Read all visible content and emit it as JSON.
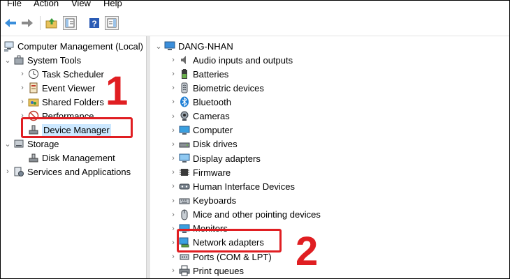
{
  "menu": [
    "File",
    "Action",
    "View",
    "Help"
  ],
  "toolbar": {
    "icons": [
      "back-arrow-icon",
      "forward-arrow-icon",
      "up-folder-icon",
      "show-hide-tree-icon",
      "help-icon",
      "properties-icon"
    ]
  },
  "tree": {
    "root": "Computer Management (Local)",
    "items": [
      {
        "label": "System Tools",
        "icon": "toolbox-icon"
      },
      {
        "label": "Task Scheduler",
        "icon": "clock-icon"
      },
      {
        "label": "Event Viewer",
        "icon": "event-viewer-icon"
      },
      {
        "label": "Shared Folders",
        "icon": "shared-folder-icon"
      },
      {
        "label": "Performance",
        "icon": "performance-icon"
      },
      {
        "label": "Device Manager",
        "icon": "device-manager-icon"
      },
      {
        "label": "Storage",
        "icon": "storage-icon"
      },
      {
        "label": "Disk Management",
        "icon": "disk-management-icon"
      },
      {
        "label": "Services and Applications",
        "icon": "services-icon"
      }
    ]
  },
  "devices": {
    "computer": "DANG-NHAN",
    "categories": [
      "Audio inputs and outputs",
      "Batteries",
      "Biometric devices",
      "Bluetooth",
      "Cameras",
      "Computer",
      "Disk drives",
      "Display adapters",
      "Firmware",
      "Human Interface Devices",
      "Keyboards",
      "Mice and other pointing devices",
      "Monitors",
      "Network adapters",
      "Ports (COM & LPT)",
      "Print queues"
    ]
  },
  "annotations": {
    "step1": "1",
    "step2": "2"
  },
  "colors": {
    "highlight": "#e01e22",
    "selection": "#cce8ff",
    "accent": "#1e7fd6"
  }
}
